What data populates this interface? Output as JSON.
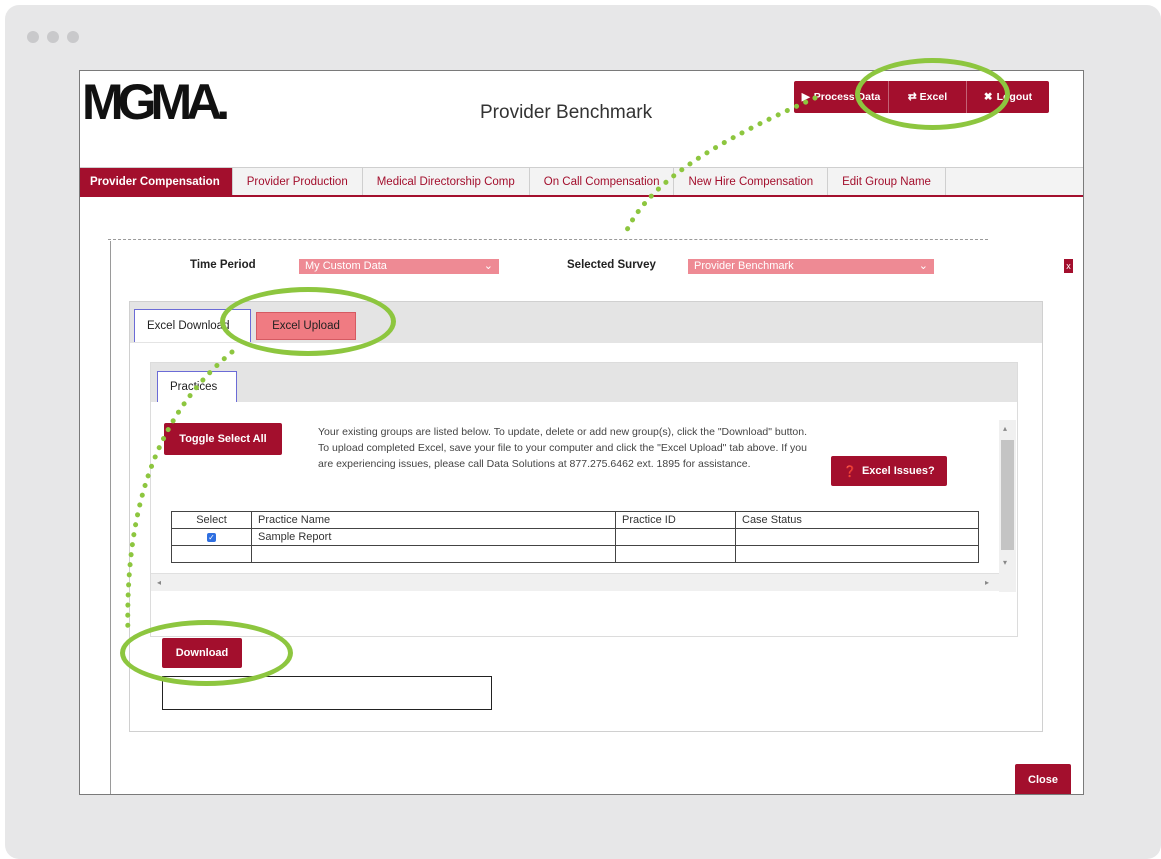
{
  "brand": {
    "logo_text": "MGMA.",
    "accent": "#a30f2d",
    "highlight": "#8dc63f"
  },
  "header": {
    "title": "Provider Benchmark"
  },
  "topbar": [
    {
      "label": "Process Data",
      "icon": "play-icon"
    },
    {
      "label": "Excel",
      "icon": "exchange-icon"
    },
    {
      "label": "Logout",
      "icon": "close-icon"
    }
  ],
  "nav": {
    "tabs": [
      {
        "label": "Provider Compensation",
        "active": true
      },
      {
        "label": "Provider Production"
      },
      {
        "label": "Medical Directorship Comp"
      },
      {
        "label": "On Call Compensation"
      },
      {
        "label": "New Hire Compensation"
      },
      {
        "label": "Edit Group Name"
      }
    ]
  },
  "modal": {
    "time_period_label": "Time Period",
    "time_period_value": "My Custom Data",
    "survey_label": "Selected Survey",
    "survey_value": "Provider Benchmark",
    "close_x": "x",
    "tabs": {
      "download": "Excel Download",
      "upload": "Excel Upload"
    },
    "practices_tab": "Practices",
    "toggle_label": "Toggle Select All",
    "info_text": "Your existing groups are listed below. To update, delete or add new group(s), click the \"Download\" button. To upload completed Excel, save your file to your computer and click the \"Excel Upload\" tab above. If you are experiencing issues, please call Data Solutions at 877.275.6462 ext. 1895 for assistance.",
    "issues_label": "Excel Issues?",
    "table": {
      "headers": [
        "Select",
        "Practice Name",
        "Practice ID",
        "Case Status"
      ],
      "rows": [
        {
          "checked": true,
          "name": "Sample Report",
          "id": "",
          "status": ""
        }
      ]
    },
    "download_label": "Download",
    "close_label": "Close"
  }
}
